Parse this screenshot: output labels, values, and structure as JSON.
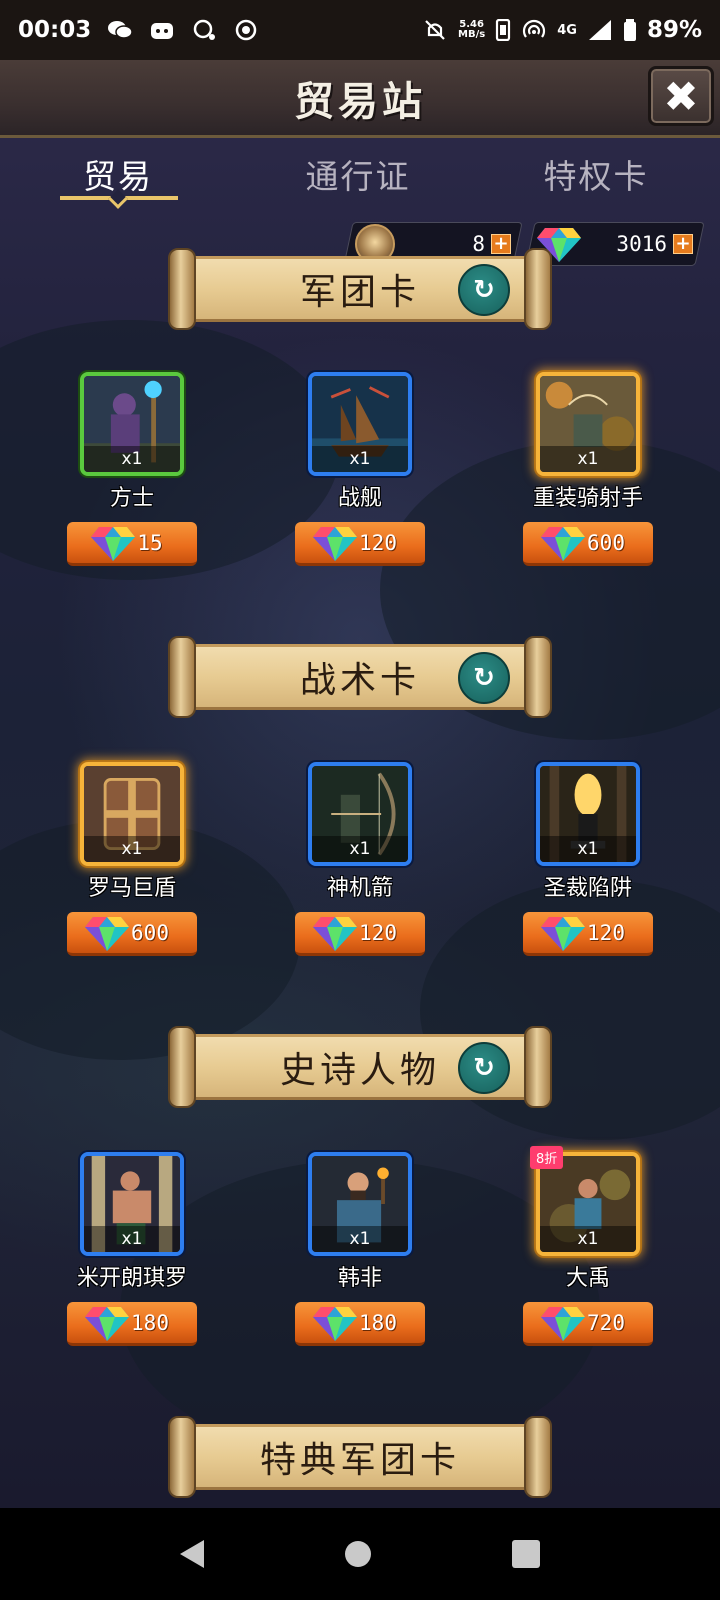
{
  "status_bar": {
    "time": "00:03",
    "net_speed_top": "5.46",
    "net_speed_unit": "MB/s",
    "signal": "4G",
    "battery": "89%"
  },
  "header": {
    "title": "贸易站",
    "close_label": "✖"
  },
  "tabs": [
    {
      "label": "贸易"
    },
    {
      "label": "通行证"
    },
    {
      "label": "特权卡"
    }
  ],
  "currency": {
    "crest_value": "8",
    "gem_value": "3016",
    "plus": "+"
  },
  "sections": [
    {
      "title": "军团卡",
      "refresh": "↻",
      "items": [
        {
          "name": "方士",
          "qty": "x1",
          "price": "15",
          "rarity": "green"
        },
        {
          "name": "战舰",
          "qty": "x1",
          "price": "120",
          "rarity": "blue"
        },
        {
          "name": "重装骑射手",
          "qty": "x1",
          "price": "600",
          "rarity": "gold"
        }
      ]
    },
    {
      "title": "战术卡",
      "refresh": "↻",
      "items": [
        {
          "name": "罗马巨盾",
          "qty": "x1",
          "price": "600",
          "rarity": "gold"
        },
        {
          "name": "神机箭",
          "qty": "x1",
          "price": "120",
          "rarity": "blue"
        },
        {
          "name": "圣裁陷阱",
          "qty": "x1",
          "price": "120",
          "rarity": "blue"
        }
      ]
    },
    {
      "title": "史诗人物",
      "refresh": "↻",
      "items": [
        {
          "name": "米开朗琪罗",
          "qty": "x1",
          "price": "180",
          "rarity": "blue"
        },
        {
          "name": "韩非",
          "qty": "x1",
          "price": "180",
          "rarity": "blue"
        },
        {
          "name": "大禹",
          "qty": "x1",
          "price": "720",
          "rarity": "gold",
          "badge": "8折"
        }
      ]
    },
    {
      "title": "特典军团卡"
    }
  ],
  "colors": {
    "accent_gold": "#e9c56a",
    "price_orange": "#ea6d1c",
    "rarity_green": "#5ac93e",
    "rarity_blue": "#2e7ef0",
    "rarity_gold": "#f6b43a"
  }
}
